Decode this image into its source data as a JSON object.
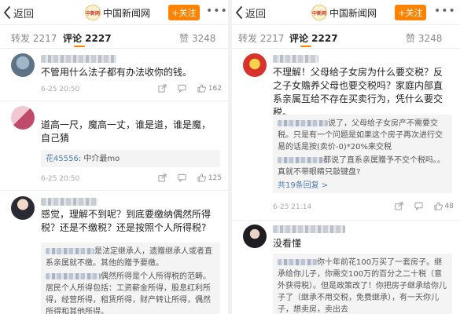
{
  "colors": {
    "accent": "#ff8200",
    "link": "#507daf"
  },
  "header": {
    "back_label": "返回",
    "logo_text": "中新网",
    "brand": "中国新闻网",
    "follow_label": "+关注",
    "more_icon": "ellipsis-icon"
  },
  "tabs": {
    "repost": "转发 2217",
    "comments": "评论 2227",
    "likes": "赞 3248"
  },
  "left": {
    "c1": {
      "text": "不管用什么法子都有办法收你的钱。",
      "time": "6-25 20:50",
      "likes": "162"
    },
    "c2": {
      "text": "道高一尺，魔高一丈，谁是道，谁是魔，自己猜",
      "reply_user": "花45556",
      "reply_text": ": 中介最mo",
      "time": "6-25 20:50",
      "likes": "125"
    },
    "c3": {
      "text": "感觉，理解不到呢？到底要缴纳偶然所得税？还是不缴税？还是按照个人所得税?",
      "reply1": "是法定继承人，遗赠继承人或者直系亲属就不缴。其他的赠予要缴。",
      "reply2": "偶然所得是个人所得税的范畴。居民个人所得包括：工资薪金所得，股息红利所得，经营所得，租赁所得，财产转让所得，偶然所得和其他所得。"
    }
  },
  "right": {
    "c1": {
      "text": "不理解！父母给子女房为什么要交税？反之子女赡养父母也要交税吗？家庭内部直系亲属互给不存在买卖行为，凭什么要交税。",
      "reply1": "说了，父母给子女房产不需要交税。只是有一个问题是如果这个房子再次进行交易的话是按(卖价-0)*20%来交税",
      "reply2": "都说了直系亲属赠予不交个税吗。。真就不带眼睛只敲键盘?",
      "reply_more": "共19条回复 >",
      "time": "6-25 21:14",
      "likes": "48"
    },
    "c2": {
      "text": "没看懂",
      "reply1": "你十年前花100万买了一套房子。继承给你儿子，你需交100万的百分之二十税（意外获得税）。但是政策改了！你把房子继承给你儿子了（继承不用交税，免费继承），有一天你儿子，想卖房，卖出去"
    }
  }
}
